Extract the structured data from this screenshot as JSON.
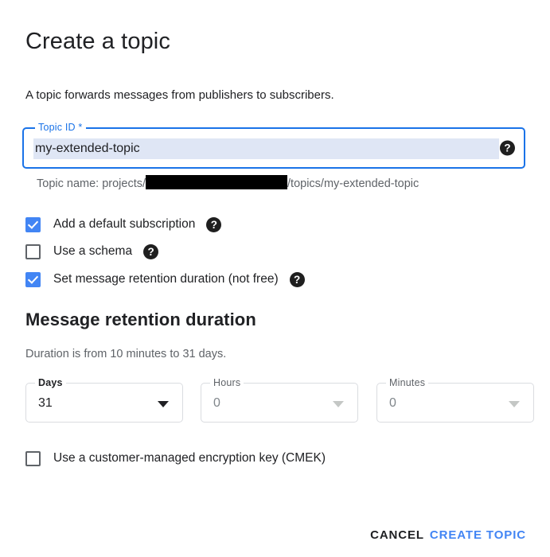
{
  "page": {
    "title": "Create a topic",
    "description": "A topic forwards messages from publishers to subscribers."
  },
  "topic_id_field": {
    "label": "Topic ID *",
    "value": "my-extended-topic",
    "placeholder": "",
    "help_icon": "help-circle-icon",
    "focused": true
  },
  "topic_name_hint": {
    "prefix": "Topic name: projects/",
    "project_id": "",
    "suffix": "/topics/my-extended-topic",
    "redacted": true
  },
  "options": [
    {
      "label": "Add a default subscription",
      "checked": true,
      "help_icon": "help-circle-icon"
    },
    {
      "label": "Use a schema",
      "checked": false,
      "help_icon": "help-circle-icon"
    },
    {
      "label": "Set message retention duration (not free)",
      "checked": true,
      "help_icon": "help-circle-icon"
    }
  ],
  "retention": {
    "title": "Message retention duration",
    "subtitle": "Duration is from 10 minutes to 31 days.",
    "fields": [
      {
        "label": "Days",
        "value": "31",
        "caret_icon": "caret-down-icon"
      },
      {
        "label": "Hours",
        "value": "0",
        "caret_icon": "caret-down-icon"
      },
      {
        "label": "Minutes",
        "value": "0",
        "caret_icon": "caret-down-icon"
      }
    ]
  },
  "cmek": {
    "label": "Use a customer-managed encryption key (CMEK)",
    "checked": false
  },
  "footer": {
    "cancel_label": "CANCEL",
    "create_label": "CREATE TOPIC"
  },
  "colors": {
    "accent_blue": "#1a73e8",
    "button_blue": "#4285f4",
    "checkbox_blue": "#4285f4",
    "text_primary": "#202124",
    "text_secondary": "#5f6368",
    "border_gray": "#dadce0",
    "selection_highlight": "#dfe6f5"
  }
}
